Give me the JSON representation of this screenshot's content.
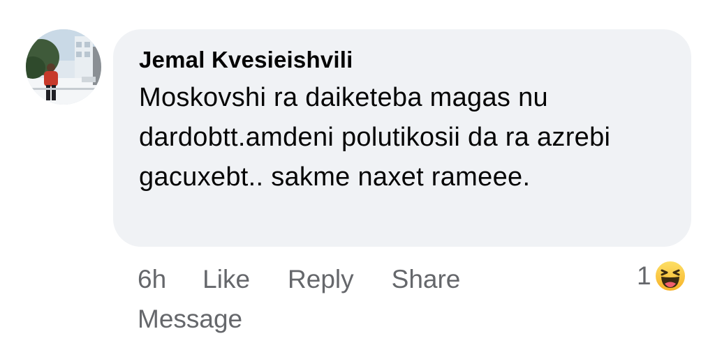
{
  "comment": {
    "author": "Jemal Kvesieishvili",
    "text": "Moskovshi ra daiketeba magas nu dardobtt.amdeni polutikosii da ra azrebi gacuxebt.. sakme naxet rameee.",
    "avatar_icon": "profile-photo"
  },
  "actions": {
    "time": "6h",
    "like": "Like",
    "reply": "Reply",
    "share": "Share",
    "message": "Message"
  },
  "reactions": {
    "count": "1",
    "icon": "haha-emoji",
    "icon_color": "#f7b125"
  },
  "colors": {
    "bubble_bg": "#f0f2f5",
    "text": "#050505",
    "secondary_text": "#65676b"
  }
}
